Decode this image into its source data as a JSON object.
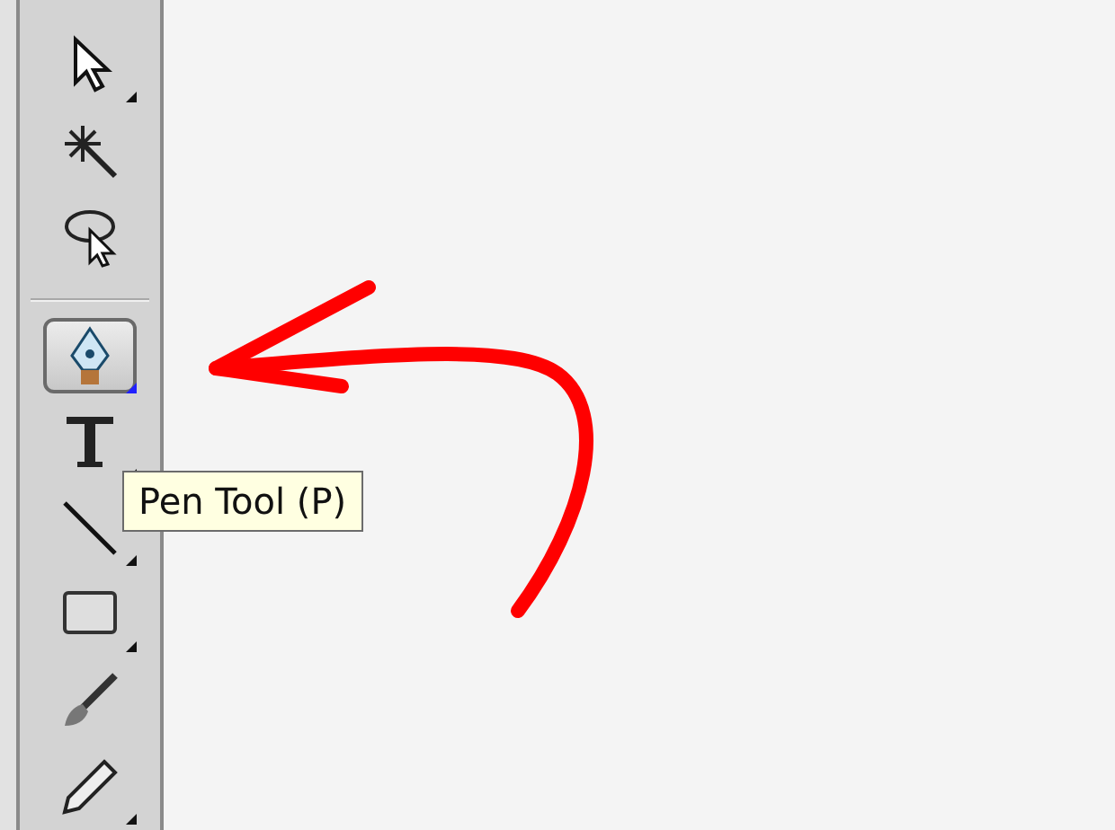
{
  "toolbar": {
    "groups": [
      {
        "tools": [
          {
            "kind": "selection",
            "selected": false,
            "flyout": true
          },
          {
            "kind": "magic-wand",
            "selected": false,
            "flyout": false
          },
          {
            "kind": "lasso",
            "selected": false,
            "flyout": false
          }
        ]
      },
      {
        "tools": [
          {
            "kind": "pen",
            "selected": true,
            "flyout": true
          },
          {
            "kind": "type",
            "selected": false,
            "flyout": true
          },
          {
            "kind": "line",
            "selected": false,
            "flyout": true
          },
          {
            "kind": "rectangle",
            "selected": false,
            "flyout": true
          },
          {
            "kind": "brush",
            "selected": false,
            "flyout": false
          },
          {
            "kind": "pencil",
            "selected": false,
            "flyout": true
          }
        ]
      }
    ]
  },
  "tooltip": {
    "text": "Pen Tool (P)"
  }
}
